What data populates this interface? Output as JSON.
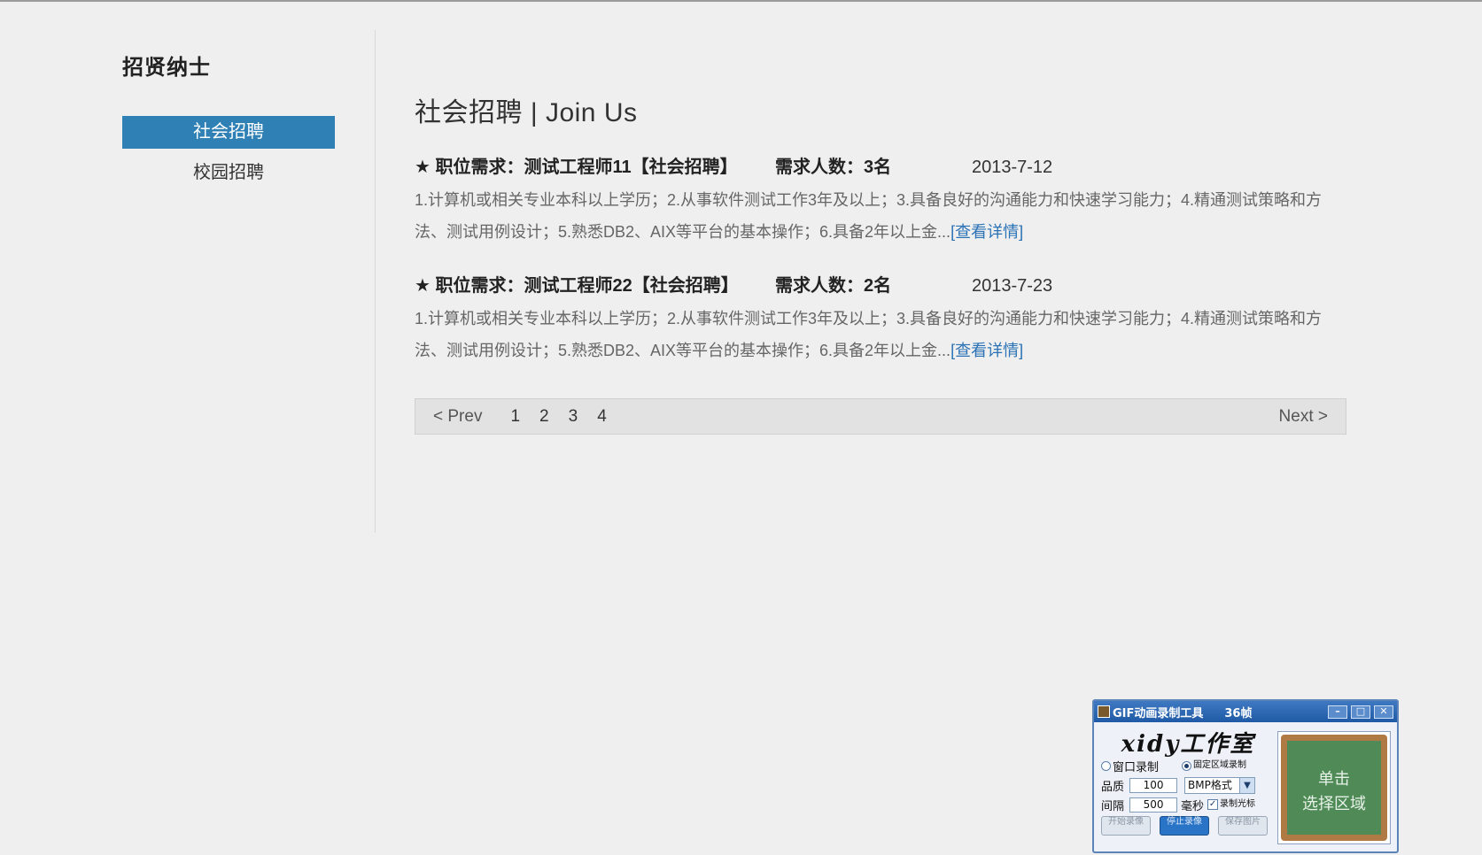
{
  "sidebar": {
    "title": "招贤纳士",
    "items": [
      {
        "label": "社会招聘",
        "active": true
      },
      {
        "label": "校园招聘",
        "active": false
      }
    ]
  },
  "main": {
    "title": "社会招聘 | Join Us",
    "jobs": [
      {
        "title": "★ 职位需求：测试工程师11【社会招聘】",
        "count": "需求人数：3名",
        "date": "2013-7-12",
        "desc": "1.计算机或相关专业本科以上学历；2.从事软件测试工作3年及以上；3.具备良好的沟通能力和快速学习能力；4.精通测试策略和方法、测试用例设计；5.熟悉DB2、AIX等平台的基本操作；6.具备2年以上金...",
        "link": "[查看详情]"
      },
      {
        "title": "★ 职位需求：测试工程师22【社会招聘】",
        "count": "需求人数：2名",
        "date": "2013-7-23",
        "desc": "1.计算机或相关专业本科以上学历；2.从事软件测试工作3年及以上；3.具备良好的沟通能力和快速学习能力；4.精通测试策略和方法、测试用例设计；5.熟悉DB2、AIX等平台的基本操作；6.具备2年以上金...",
        "link": "[查看详情]"
      }
    ],
    "pager": {
      "prev": "< Prev",
      "pages": [
        "1",
        "2",
        "3",
        "4"
      ],
      "next": "Next >"
    }
  },
  "gif_tool": {
    "title": "GIF动画录制工具",
    "frames": "36帧",
    "brand": "xidy工作室",
    "window_record": "窗口录制",
    "region_record": "固定区域录制",
    "quality_label": "品质",
    "quality_value": "100",
    "format_value": "BMP格式",
    "interval_label": "间隔",
    "interval_value": "500",
    "interval_unit": "毫秒",
    "no_cursor": "录制光标",
    "btn_start": "开始录像",
    "btn_stop": "停止录像",
    "btn_save": "保存图片",
    "select_region": "单击\n选择区域"
  },
  "colors": {
    "accent": "#2f80b5",
    "link": "#2a72b5",
    "background": "#efefef"
  }
}
